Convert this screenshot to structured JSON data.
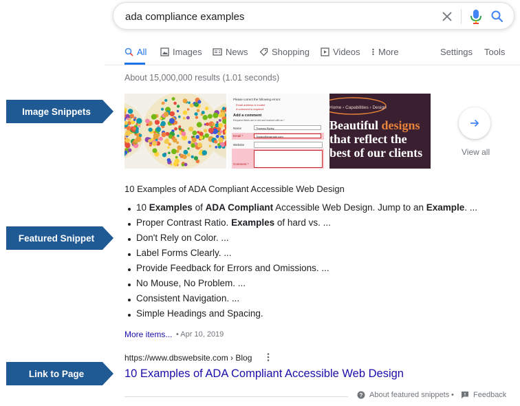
{
  "search": {
    "query": "ada compliance examples"
  },
  "tabs": [
    {
      "label": "All"
    },
    {
      "label": "Images"
    },
    {
      "label": "News"
    },
    {
      "label": "Shopping"
    },
    {
      "label": "Videos"
    },
    {
      "label": "More"
    }
  ],
  "tools": {
    "settings": "Settings",
    "tools": "Tools"
  },
  "results_count": "About 15,000,000 results (1.01 seconds)",
  "callouts": {
    "image_snippets": "Image Snippets",
    "featured_snippet": "Featured Snippet",
    "link_to_page": "Link to Page"
  },
  "images": {
    "view_all": "View all",
    "tile2": {
      "error_title": "Please correct the following errors:",
      "error1": "Email address is invalid",
      "error2": "A comment is required",
      "add_comment": "Add a comment",
      "required_note": "Required fields are in red and marked with an *",
      "name_label": "Name",
      "name_value": "Thomas Ripley",
      "email_label": "Email *",
      "email_value": "Tripley@example.com",
      "website_label": "Website",
      "comment_label": "Comment *"
    },
    "tile3": {
      "breadcrumb": "Home › Capabilities › Design",
      "line1_a": "Beautiful ",
      "line1_b": "designs",
      "line2": "that reflect the",
      "line3": "best of our clients"
    }
  },
  "snippet": {
    "heading": "10 Examples of ADA Compliant Accessible Web Design",
    "items": [
      {
        "t1": "10 ",
        "b1": "Examples",
        "t2": " of ",
        "b2": "ADA Compliant",
        "t3": " Accessible Web Design. Jump to an ",
        "b3": "Example",
        "t4": ". ..."
      },
      {
        "t1": "Proper Contrast Ratio. ",
        "b1": "Examples",
        "t2": " of hard vs. ..."
      },
      {
        "t1": "Don't Rely on Color. ..."
      },
      {
        "t1": "Label Forms Clearly. ..."
      },
      {
        "t1": "Provide Feedback for Errors and Omissions. ..."
      },
      {
        "t1": "No Mouse, No Problem. ..."
      },
      {
        "t1": "Consistent Navigation. ..."
      },
      {
        "t1": "Simple Headings and Spacing."
      }
    ],
    "more_items": "More items...",
    "date": "• Apr 10, 2019"
  },
  "result": {
    "cite": "https://www.dbswebsite.com › Blog",
    "title": "10 Examples of ADA Compliant Accessible Web Design"
  },
  "footer": {
    "about": "About featured snippets",
    "bullet": "•",
    "feedback": "Feedback"
  },
  "colors": {
    "link": "#1a0dab",
    "accent": "#1a73e8",
    "callout": "#1f5a95",
    "tile3_bg": "#3a1f30",
    "tile3_accent": "#e8843a"
  }
}
